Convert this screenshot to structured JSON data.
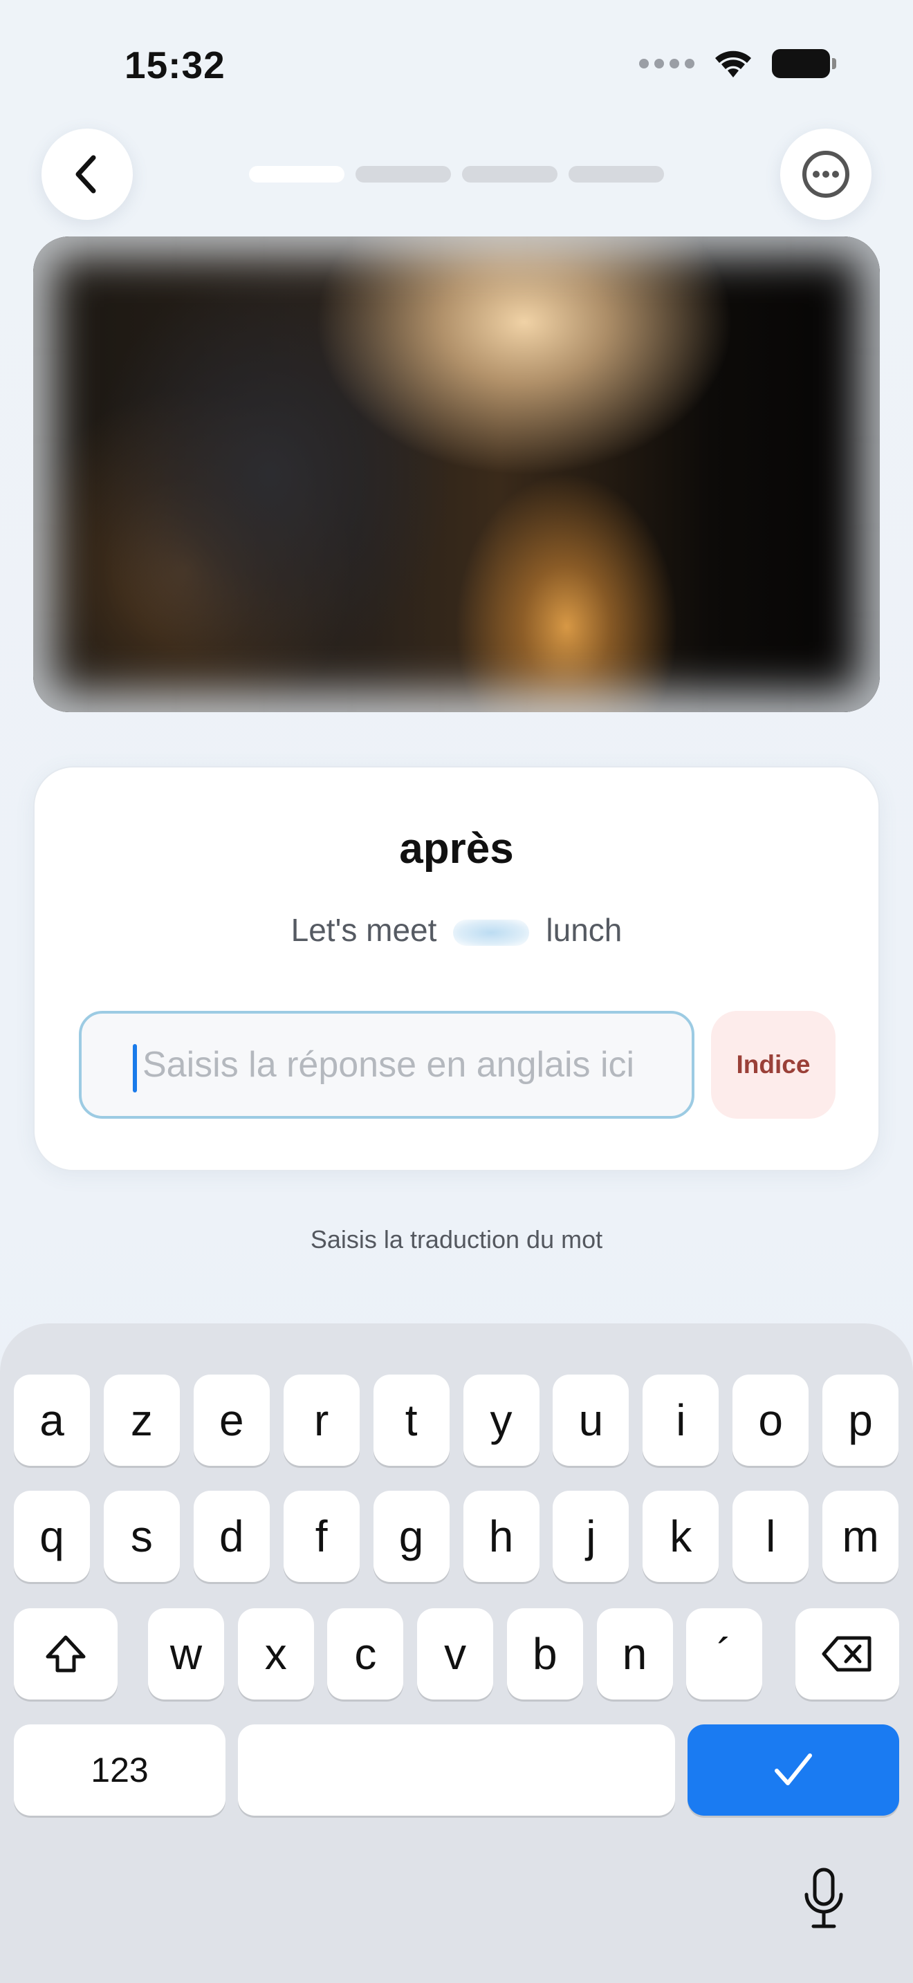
{
  "status_bar": {
    "time": "15:32"
  },
  "progress": {
    "total_steps": 4,
    "current_step": 1
  },
  "card": {
    "word": "après",
    "sentence_before": "Let's meet",
    "sentence_after": "lunch",
    "input_value": "",
    "input_placeholder": "Saisis la réponse en anglais ici",
    "hint_label": "Indice"
  },
  "instruction": "Saisis la traduction du mot",
  "keyboard": {
    "row1": [
      "a",
      "z",
      "e",
      "r",
      "t",
      "y",
      "u",
      "i",
      "o",
      "p"
    ],
    "row2": [
      "q",
      "s",
      "d",
      "f",
      "g",
      "h",
      "j",
      "k",
      "l",
      "m"
    ],
    "row3": [
      "w",
      "x",
      "c",
      "v",
      "b",
      "n",
      "´"
    ],
    "numbers_label": "123",
    "submit_icon": "checkmark-icon",
    "accent_color": "#1a7bf2"
  },
  "colors": {
    "accent": "#1a7bf2",
    "hint_bg": "#fdeceb",
    "hint_text": "#9a4038"
  }
}
